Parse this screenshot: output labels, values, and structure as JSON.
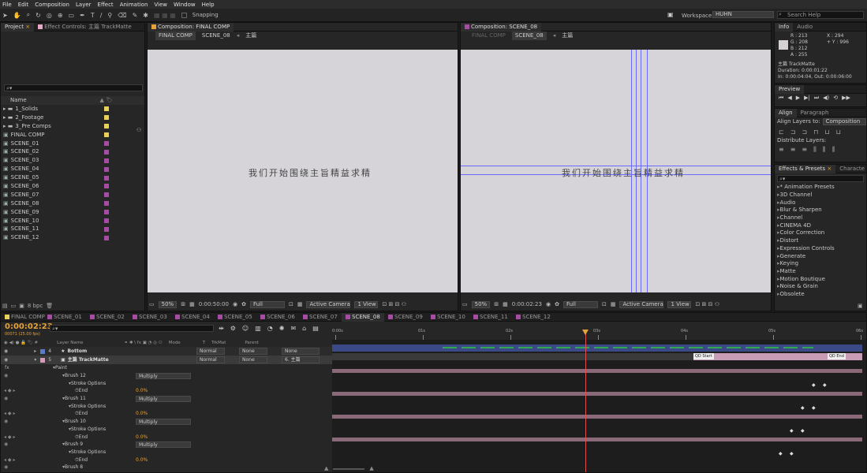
{
  "menu": [
    "File",
    "Edit",
    "Composition",
    "Layer",
    "Effect",
    "Animation",
    "View",
    "Window",
    "Help"
  ],
  "toolbar": {
    "snapping": "Snapping",
    "workspace_label": "Workspace:",
    "workspace_value": "HUHN",
    "search_placeholder": "Search Help"
  },
  "project": {
    "tab_project": "Project",
    "tab_effect": "Effect Controls: 主篇  TrackMatte",
    "col_name": "Name",
    "bpc": "8 bpc",
    "items": [
      {
        "name": "1_Solids",
        "type": "folder",
        "color": "#e8d15a"
      },
      {
        "name": "2_Footage",
        "type": "folder",
        "color": "#e8d15a"
      },
      {
        "name": "3_Pre Comps",
        "type": "folder",
        "color": "#e8d15a"
      },
      {
        "name": "FINAL COMP",
        "type": "comp",
        "color": "#e8d15a"
      },
      {
        "name": "SCENE_01",
        "type": "comp",
        "color": "#a64ca6"
      },
      {
        "name": "SCENE_02",
        "type": "comp",
        "color": "#a64ca6"
      },
      {
        "name": "SCENE_03",
        "type": "comp",
        "color": "#a64ca6"
      },
      {
        "name": "SCENE_04",
        "type": "comp",
        "color": "#a64ca6"
      },
      {
        "name": "SCENE_05",
        "type": "comp",
        "color": "#a64ca6"
      },
      {
        "name": "SCENE_06",
        "type": "comp",
        "color": "#a64ca6"
      },
      {
        "name": "SCENE_07",
        "type": "comp",
        "color": "#a64ca6"
      },
      {
        "name": "SCENE_08",
        "type": "comp",
        "color": "#a64ca6"
      },
      {
        "name": "SCENE_09",
        "type": "comp",
        "color": "#a64ca6"
      },
      {
        "name": "SCENE_10",
        "type": "comp",
        "color": "#a64ca6"
      },
      {
        "name": "SCENE_11",
        "type": "comp",
        "color": "#a64ca6"
      },
      {
        "name": "SCENE_12",
        "type": "comp",
        "color": "#a64ca6"
      }
    ]
  },
  "comp1": {
    "tab": "Composition: FINAL COMP",
    "crumbs": [
      "FINAL COMP",
      "SCENE_08",
      "主篇"
    ],
    "text": "我们开始围绕主旨精益求精",
    "zoom": "50%",
    "time": "0:00:50:00",
    "res": "Full",
    "camera": "Active Camera",
    "views": "1 View"
  },
  "comp2": {
    "tab": "Composition: SCENE_08",
    "crumbs": [
      "FINAL COMP",
      "SCENE_08",
      "主篇"
    ],
    "text": "我们开始围绕主旨精益求精",
    "zoom": "50%",
    "time": "0:00:02:23",
    "res": "Full",
    "camera": "Active Camera",
    "views": "1 View"
  },
  "info": {
    "tab": "Info",
    "tab2": "Audio",
    "r": "R : 213",
    "g": "G : 208",
    "b": "B : 212",
    "a": "A : 255",
    "x": "X : 294",
    "y": "+ Y : 996",
    "layer": "主篇  TrackMatte",
    "duration": "Duration: 0:00:01:22",
    "inout": "In: 0:00:04:04, Out: 0:00:06:00"
  },
  "preview": {
    "tab": "Preview"
  },
  "align": {
    "tab": "Align",
    "tab2": "Paragraph",
    "label": "Align Layers to:",
    "value": "Composition",
    "distribute": "Distribute Layers:"
  },
  "effects": {
    "tab": "Effects & Presets",
    "tab2": "Characte",
    "items": [
      "* Animation Presets",
      "3D Channel",
      "Audio",
      "Blur & Sharpen",
      "Channel",
      "CINEMA 4D",
      "Color Correction",
      "Distort",
      "Expression Controls",
      "Generate",
      "Keying",
      "Matte",
      "Motion Boutique",
      "Noise & Grain",
      "Obsolete"
    ]
  },
  "timeline": {
    "tabs": [
      {
        "label": "FINAL COMP",
        "color": "#e8d15a"
      },
      {
        "label": "SCENE_01",
        "color": "#a64ca6"
      },
      {
        "label": "SCENE_02",
        "color": "#a64ca6"
      },
      {
        "label": "SCENE_03",
        "color": "#a64ca6"
      },
      {
        "label": "SCENE_04",
        "color": "#a64ca6"
      },
      {
        "label": "SCENE_05",
        "color": "#a64ca6"
      },
      {
        "label": "SCENE_06",
        "color": "#a64ca6"
      },
      {
        "label": "SCENE_07",
        "color": "#a64ca6"
      },
      {
        "label": "SCENE_08",
        "color": "#a64ca6"
      },
      {
        "label": "SCENE_09",
        "color": "#a64ca6"
      },
      {
        "label": "SCENE_10",
        "color": "#a64ca6"
      },
      {
        "label": "SCENE_11",
        "color": "#a64ca6"
      },
      {
        "label": "SCENE_12",
        "color": "#a64ca6"
      }
    ],
    "timecode": "0:00:02:23",
    "frames": "00071 (25.00 fps)",
    "cols": {
      "layer_name": "Layer Name",
      "mode": "Mode",
      "t": "T",
      "trkmat": "TrkMat",
      "parent": "Parent"
    },
    "ruler": [
      "0:00s",
      "01s",
      "02s",
      "03s",
      "04s",
      "05s",
      "06s"
    ],
    "layers": [
      {
        "num": "4",
        "name": "Bottom",
        "mode": "Normal",
        "trkmat": "None",
        "parent": "None"
      },
      {
        "num": "5",
        "name": "主篇  TrackMatte",
        "mode": "Normal",
        "trkmat": "None",
        "parent": "6. 主篇"
      }
    ],
    "props": [
      {
        "label": "Paint",
        "indent": 0
      },
      {
        "label": "Brush 12",
        "indent": 1,
        "mode": "Multiply"
      },
      {
        "label": "Stroke Options",
        "indent": 2
      },
      {
        "label": "End",
        "indent": 3,
        "value": "0.0%"
      },
      {
        "label": "Brush 11",
        "indent": 1,
        "mode": "Multiply"
      },
      {
        "label": "Stroke Options",
        "indent": 2
      },
      {
        "label": "End",
        "indent": 3,
        "value": "0.0%"
      },
      {
        "label": "Brush 10",
        "indent": 1,
        "mode": "Multiply"
      },
      {
        "label": "Stroke Options",
        "indent": 2
      },
      {
        "label": "End",
        "indent": 3,
        "value": "0.0%"
      },
      {
        "label": "Brush 9",
        "indent": 1,
        "mode": "Multiply"
      },
      {
        "label": "Stroke Options",
        "indent": 2
      },
      {
        "label": "End",
        "indent": 3,
        "value": "0.0%"
      },
      {
        "label": "Brush 8",
        "indent": 1
      }
    ],
    "marker_start": "QD Start",
    "marker_end": "QD End",
    "colors": {
      "bottom_bar": "#3b4a86",
      "matte_bar": "#c79cb4",
      "brush_bar": "#8a6a78",
      "playhead": "#e05050",
      "green": "#2fa84f"
    }
  }
}
